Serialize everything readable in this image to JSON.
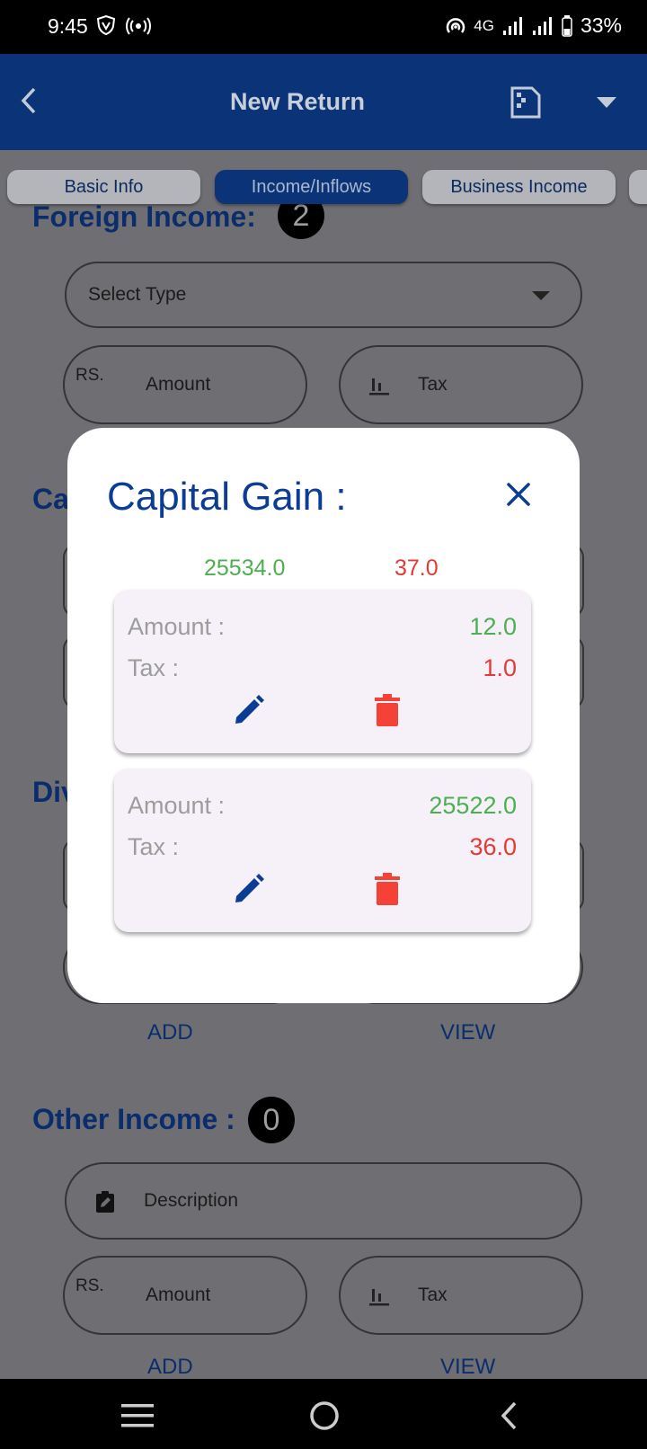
{
  "status_bar": {
    "time": "9:45",
    "network": "4G",
    "battery": "33%"
  },
  "app_bar": {
    "title": "New Return"
  },
  "tabs": [
    {
      "label": "Basic Info",
      "active": false
    },
    {
      "label": "Income/Inflows",
      "active": true
    },
    {
      "label": "Business Income",
      "active": false
    }
  ],
  "foreign_income": {
    "title": "Foreign Income:",
    "count": "2",
    "select_placeholder": "Select Type",
    "currency": "RS.",
    "amount_label": "Amount",
    "tax_label": "Tax"
  },
  "capital_gain_partial": "Ca",
  "dividend_partial": "Div",
  "links": {
    "add": "ADD",
    "view": "VIEW"
  },
  "other_income": {
    "title": "Other Income :",
    "count": "0",
    "description_label": "Description",
    "currency": "RS.",
    "amount_label": "Amount",
    "tax_label": "Tax"
  },
  "dialog": {
    "title": "Capital Gain :",
    "total_amount": "25534.0",
    "total_tax": "37.0",
    "amount_key": "Amount :",
    "tax_key": "Tax :",
    "entries": [
      {
        "amount": "12.0",
        "tax": "1.0"
      },
      {
        "amount": "25522.0",
        "tax": "36.0"
      }
    ]
  },
  "colors": {
    "primary": "#0a3378",
    "accent_blue": "#0c3d94",
    "green": "#4caf50",
    "red": "#e53935",
    "delete": "#f44336"
  }
}
